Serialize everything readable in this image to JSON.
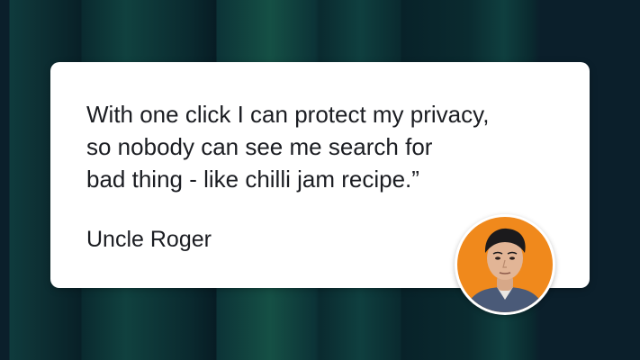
{
  "testimonial": {
    "quote_lines": [
      "With one click I can protect my privacy,",
      "so nobody can see me search for",
      "bad thing - like chilli jam recipe.”"
    ],
    "author": "Uncle Roger"
  },
  "colors": {
    "background": "#0b1f2b",
    "card": "#ffffff",
    "text": "#1b1d22",
    "avatar_bg": "#f0891c"
  },
  "icons": {
    "avatar": "person-photo"
  }
}
